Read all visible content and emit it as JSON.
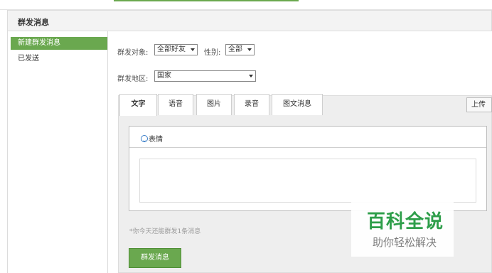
{
  "header": {
    "title": "群发消息"
  },
  "sidebar": {
    "items": [
      {
        "label": "新建群发消息",
        "active": true
      },
      {
        "label": "已发送",
        "active": false
      }
    ]
  },
  "form": {
    "target_label": "群发对象:",
    "target_value": "全部好友",
    "gender_label": "性别:",
    "gender_value": "全部",
    "region_label": "群发地区:",
    "region_value": "国家"
  },
  "tabs": [
    {
      "label": "文字",
      "active": true
    },
    {
      "label": "语音",
      "active": false
    },
    {
      "label": "图片",
      "active": false
    },
    {
      "label": "录音",
      "active": false
    },
    {
      "label": "图文消息",
      "active": false
    }
  ],
  "upload_label": "上传",
  "editor": {
    "emoji_label": "表情",
    "emoji_icon": "smiley-icon"
  },
  "hint": "*你今天还能群发1条消息",
  "send_label": "群发消息",
  "watermark": {
    "title": "百科全说",
    "subtitle": "助你轻松解决"
  },
  "colors": {
    "accent": "#6aa84f",
    "watermark_green": "#2e9e4a"
  }
}
